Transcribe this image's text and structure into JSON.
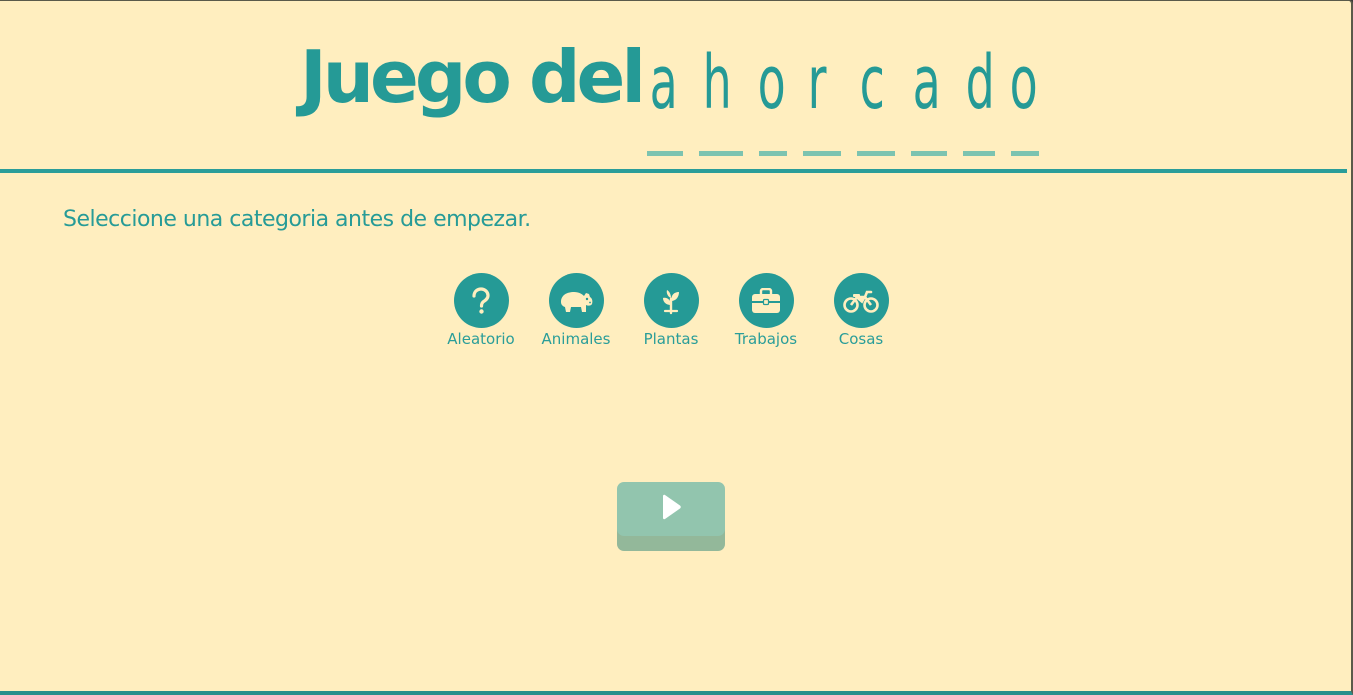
{
  "header": {
    "title_prefix": "Juego del",
    "title_letters": [
      "a",
      "h",
      "o",
      "r",
      "c",
      "a",
      "d",
      "o"
    ]
  },
  "main": {
    "prompt": "Seleccione una categoria antes de empezar.",
    "categories": [
      {
        "label": "Aleatorio",
        "icon": "question-icon"
      },
      {
        "label": "Animales",
        "icon": "hippo-icon"
      },
      {
        "label": "Plantas",
        "icon": "seedling-icon"
      },
      {
        "label": "Trabajos",
        "icon": "briefcase-icon"
      },
      {
        "label": "Cosas",
        "icon": "motorcycle-icon"
      }
    ],
    "play_button": {
      "icon": "play-icon"
    }
  },
  "colors": {
    "background": "#ffeebf",
    "accent": "#259a96",
    "dash": "#7cc3b0",
    "play_button": "#92c5ae",
    "icon_fill": "#ffeebf"
  }
}
